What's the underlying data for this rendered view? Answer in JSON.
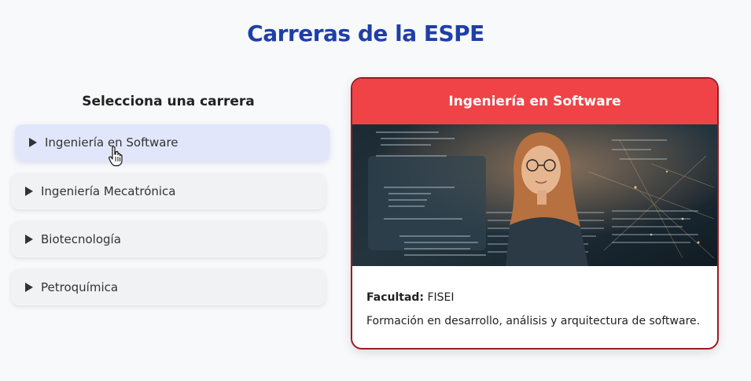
{
  "page": {
    "title": "Carreras de la ESPE"
  },
  "selector": {
    "title": "Selecciona una carrera",
    "items": [
      {
        "label": "Ingeniería en Software",
        "selected": true
      },
      {
        "label": "Ingeniería Mecatrónica",
        "selected": false
      },
      {
        "label": "Biotecnología",
        "selected": false
      },
      {
        "label": "Petroquímica",
        "selected": false
      }
    ]
  },
  "detail": {
    "header": "Ingeniería en Software",
    "faculty_label": "Facultad:",
    "faculty_value": "FISEI",
    "description": "Formación en desarrollo, análisis y arquitectura de software.",
    "image_icon": "woman-at-laptop-with-code-overlay"
  },
  "colors": {
    "title": "#1e3fa8",
    "card_header": "#ef4347",
    "card_border": "#9b1c24",
    "selected_item": "#e2e6fb"
  }
}
